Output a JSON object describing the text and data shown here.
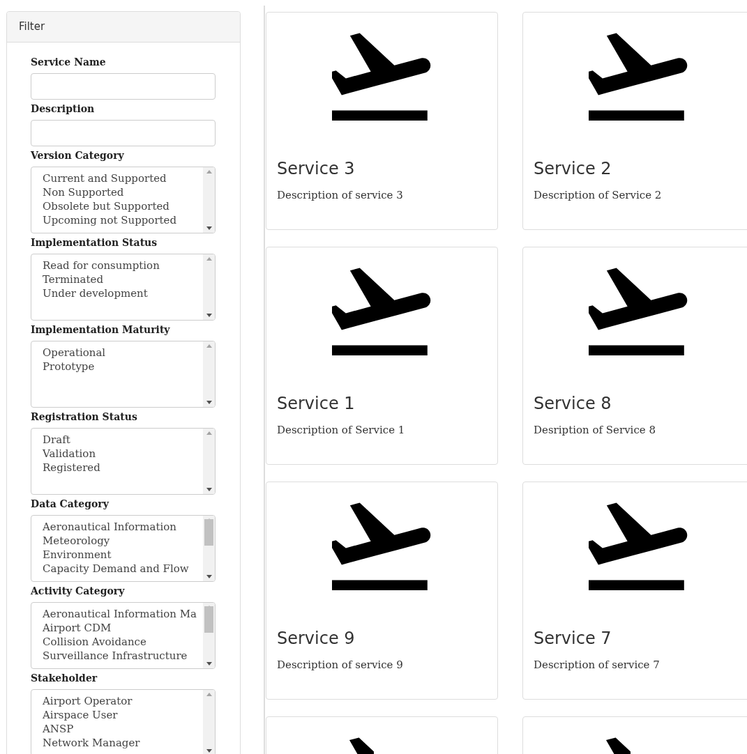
{
  "filter": {
    "title": "Filter",
    "fields": [
      {
        "kind": "text",
        "label": "Service Name"
      },
      {
        "kind": "text",
        "label": "Description"
      },
      {
        "kind": "list",
        "label": "Version Category",
        "scroll_thumb": false,
        "options": [
          "Current and Supported",
          "Non Supported",
          "Obsolete but Supported",
          "Upcoming not Supported"
        ]
      },
      {
        "kind": "list",
        "label": "Implementation Status",
        "scroll_thumb": false,
        "options": [
          "Read for consumption",
          "Terminated",
          "Under development"
        ]
      },
      {
        "kind": "list",
        "label": "Implementation Maturity",
        "scroll_thumb": false,
        "options": [
          "Operational",
          "Prototype"
        ]
      },
      {
        "kind": "list",
        "label": "Registration Status",
        "scroll_thumb": false,
        "options": [
          "Draft",
          "Validation",
          "Registered"
        ]
      },
      {
        "kind": "list",
        "label": "Data Category",
        "scroll_thumb": true,
        "options": [
          "Aeronautical Information",
          "Meteorology",
          "Environment",
          "Capacity Demand and Flow"
        ]
      },
      {
        "kind": "list",
        "label": "Activity Category",
        "scroll_thumb": true,
        "options": [
          "Aeronautical Information Ma",
          "Airport CDM",
          "Collision Avoidance",
          "Surveillance Infrastructure"
        ]
      },
      {
        "kind": "list",
        "label": "Stakeholder",
        "scroll_thumb": false,
        "options": [
          "Airport Operator",
          "Airspace User",
          "ANSP",
          "Network Manager"
        ]
      }
    ]
  },
  "services": [
    {
      "kind": "full",
      "title": "Service 3",
      "description": "Description of service 3"
    },
    {
      "kind": "full",
      "title": "Service 2",
      "description": "Description of Service 2"
    },
    {
      "kind": "full",
      "title": "Service 1",
      "description": "Description of Service 1"
    },
    {
      "kind": "full",
      "title": "Service 8",
      "description": "Desription of Service 8"
    },
    {
      "kind": "full",
      "title": "Service 9",
      "description": "Description of service 9"
    },
    {
      "kind": "full",
      "title": "Service 7",
      "description": "Description of service 7"
    },
    {
      "kind": "partial"
    },
    {
      "kind": "partial"
    }
  ]
}
